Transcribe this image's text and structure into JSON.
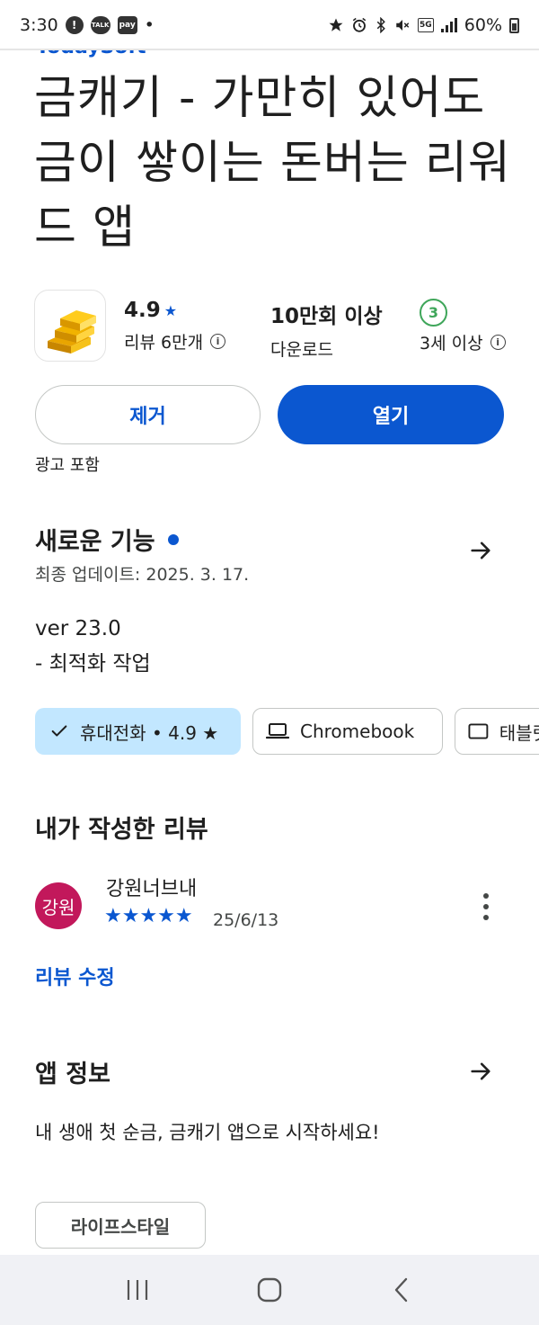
{
  "status_bar": {
    "time": "3:30",
    "notif_icons": [
      "alert-icon",
      "kakaotalk-icon",
      "pay-icon"
    ],
    "dot": "•",
    "talk_label": "TALK",
    "pay_label": "pay",
    "network": "5G",
    "battery": "60%"
  },
  "app": {
    "developer": "TodaySoft",
    "title": "금캐기 - 가만히 있어도 금이 쌓이는 돈버는 리워드 앱",
    "rating": "4.9",
    "reviews_label": "리뷰 6만개",
    "downloads": "10만회 이상",
    "downloads_label": "다운로드",
    "age_badge": "3",
    "age_label": "3세 이상",
    "icon": "gold-bars-icon"
  },
  "actions": {
    "remove_label": "제거",
    "open_label": "열기",
    "ads_note": "광고 포함"
  },
  "whats_new": {
    "title": "새로운 기능",
    "updated": "최종 업데이트: 2025. 3. 17.",
    "notes_line1": "ver 23.0",
    "notes_line2": "- 최적화 작업"
  },
  "device_chips": {
    "phone": "휴대전화 • 4.9 ★",
    "chromebook": "Chromebook",
    "tablet": "태블릿"
  },
  "my_review": {
    "section_title": "내가 작성한 리뷰",
    "avatar_text": "강원",
    "reviewer": "강원너브내",
    "stars": "★★★★★",
    "star_count": 5,
    "date": "25/6/13",
    "edit_label": "리뷰 수정"
  },
  "about": {
    "title": "앱 정보",
    "description": "내 생애 첫 순금, 금캐기 앱으로 시작하세요!",
    "category": "라이프스타일"
  },
  "colors": {
    "accent": "#0b57d0",
    "chip_selected": "#c2e7ff",
    "avatar": "#c2185b",
    "age_badge": "#3fa65a"
  }
}
